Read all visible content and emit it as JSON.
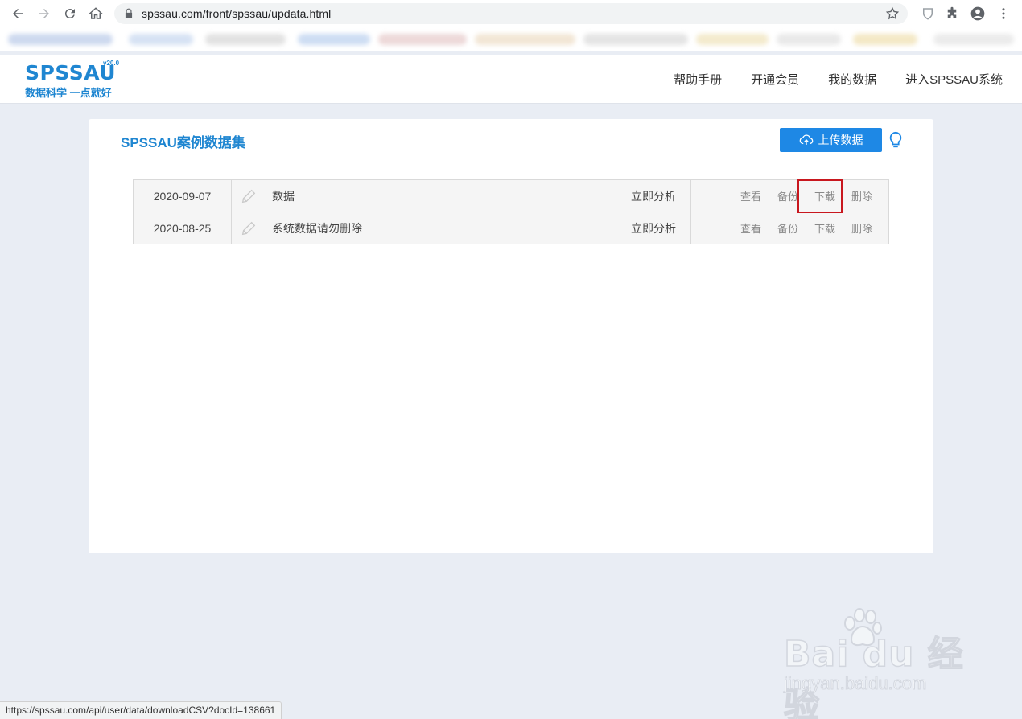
{
  "browser": {
    "url": "spssau.com/front/spssau/updata.html",
    "status_url": "https://spssau.com/api/user/data/downloadCSV?docId=138661"
  },
  "site": {
    "logo": "SPSSAU",
    "version": "v20.0",
    "slogan": "数据科学 一点就好",
    "nav": [
      "帮助手册",
      "开通会员",
      "我的数据",
      "进入SPSSAU系统"
    ]
  },
  "panel": {
    "title": "SPSSAU案例数据集",
    "upload_label": "上传数据"
  },
  "rows": [
    {
      "date": "2020-09-07",
      "name": "数据",
      "analyze": "立即分析",
      "ops": [
        "查看",
        "备份",
        "下载",
        "删除"
      ]
    },
    {
      "date": "2020-08-25",
      "name": "系统数据请勿删除",
      "analyze": "立即分析",
      "ops": [
        "查看",
        "备份",
        "下载",
        "删除"
      ]
    }
  ],
  "watermark": {
    "main": "Bai du 经验",
    "sub": "jingyan.baidu.com"
  },
  "colors": {
    "brand": "#1f86d1",
    "button": "#1e88e5",
    "highlight": "#c8171e"
  }
}
